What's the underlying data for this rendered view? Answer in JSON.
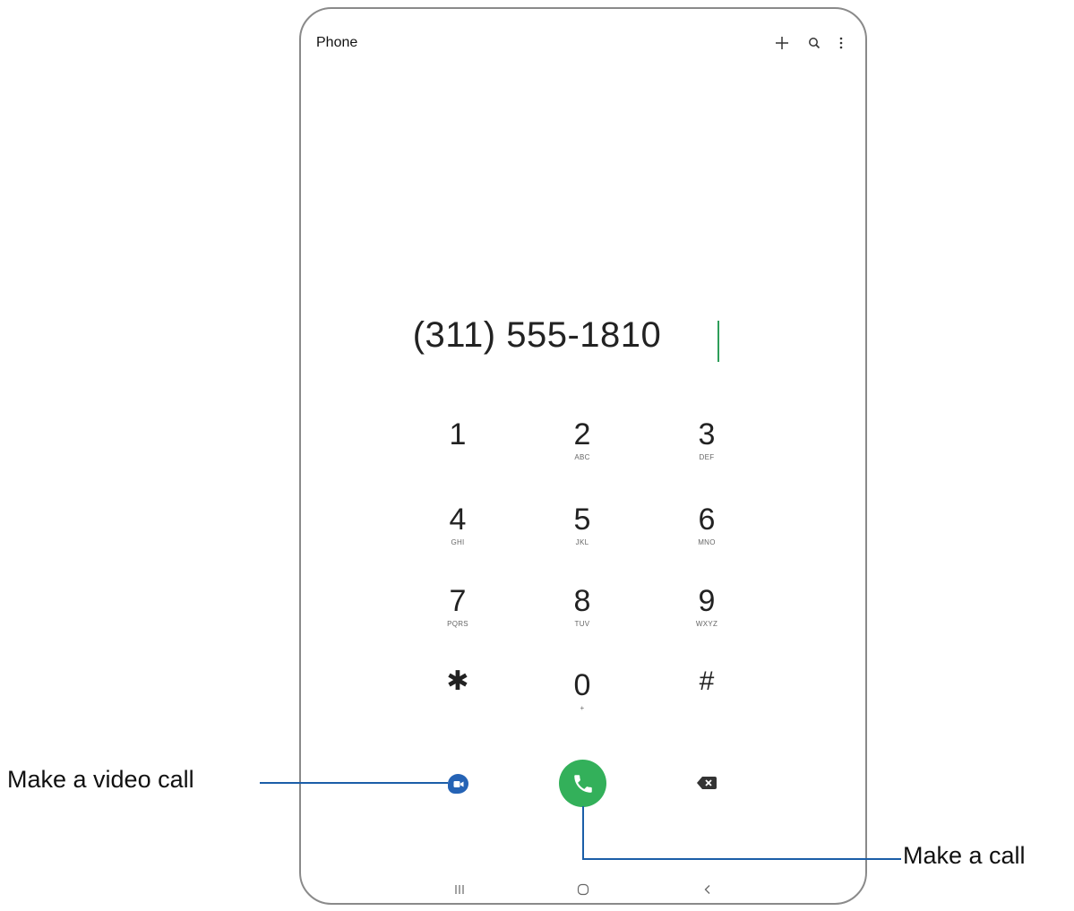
{
  "header": {
    "title": "Phone",
    "add_icon": "plus-icon",
    "search_icon": "search-icon",
    "more_icon": "more-vert-icon"
  },
  "dialer": {
    "number": "(311) 555-1810"
  },
  "keypad": [
    {
      "digit": "1",
      "letters": ""
    },
    {
      "digit": "2",
      "letters": "ABC"
    },
    {
      "digit": "3",
      "letters": "DEF"
    },
    {
      "digit": "4",
      "letters": "GHI"
    },
    {
      "digit": "5",
      "letters": "JKL"
    },
    {
      "digit": "6",
      "letters": "MNO"
    },
    {
      "digit": "7",
      "letters": "PQRS"
    },
    {
      "digit": "8",
      "letters": "TUV"
    },
    {
      "digit": "9",
      "letters": "WXYZ"
    },
    {
      "digit": "✱",
      "letters": ""
    },
    {
      "digit": "0",
      "letters": "+"
    },
    {
      "digit": "#",
      "letters": ""
    }
  ],
  "actions": {
    "video_call_icon": "video-call-icon",
    "call_icon": "phone-icon",
    "backspace_icon": "backspace-icon"
  },
  "navbar": {
    "recents_icon": "recents-icon",
    "home_icon": "home-icon",
    "back_icon": "back-icon"
  },
  "callouts": {
    "video_call": "Make a video call",
    "call": "Make a call"
  },
  "colors": {
    "call_green": "#33b05a",
    "video_blue": "#2563b5",
    "callout_line": "#1b5ea8",
    "cursor_green": "#2e9e5a"
  }
}
